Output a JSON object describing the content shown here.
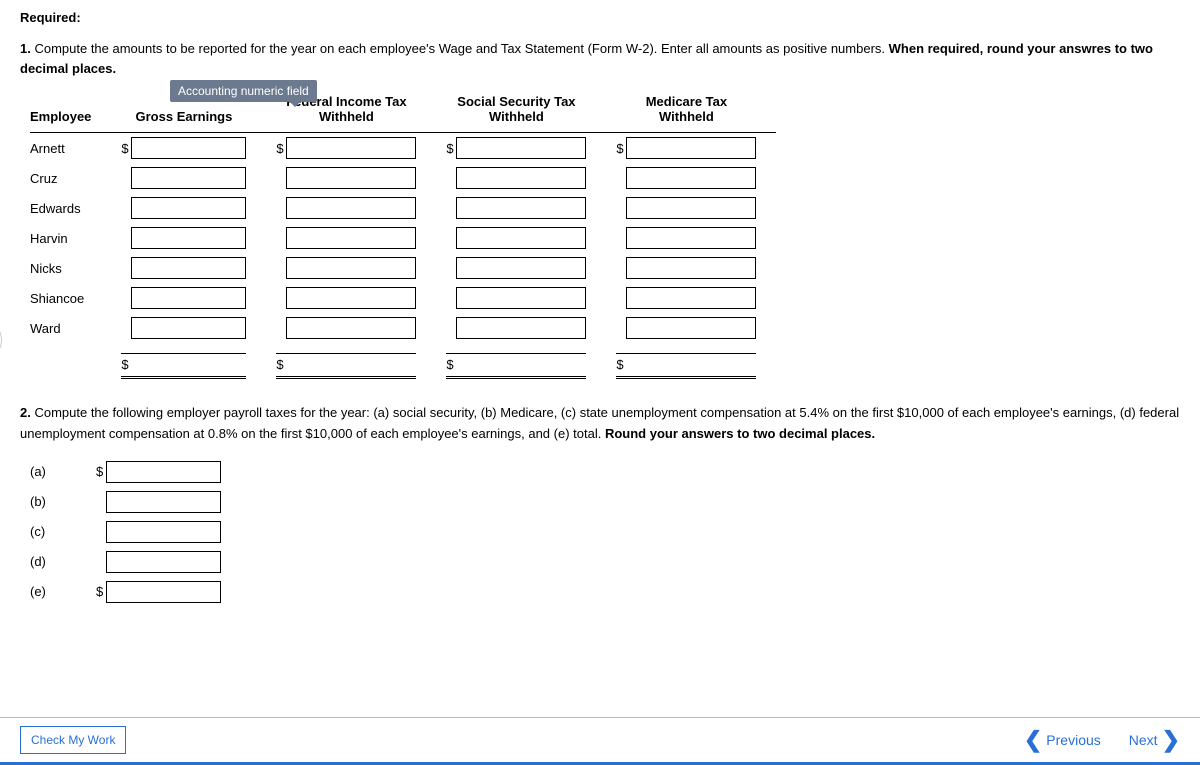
{
  "required_label": "Required:",
  "q1": {
    "num": "1.",
    "text_a": "  Compute the amounts to be reported for the year on each employee's Wage and Tax Statement (Form W-2). Enter all amounts as positive numbers. ",
    "bold": "When required, round your answres to two decimal places."
  },
  "tooltip": "Accounting numeric field",
  "headers": {
    "employee": "Employee",
    "gross": "Gross Earnings",
    "fed_a": "Federal Income Tax",
    "fed_b": "Withheld",
    "ss_a": "Social Security Tax",
    "ss_b": "Withheld",
    "med_a": "Medicare Tax",
    "med_b": "Withheld"
  },
  "employees": [
    "Arnett",
    "Cruz",
    "Edwards",
    "Harvin",
    "Nicks",
    "Shiancoe",
    "Ward"
  ],
  "dollar": "$",
  "q2": {
    "num": "2.",
    "text": "  Compute the following employer payroll taxes for the year: (a) social security, (b) Medicare, (c) state unemployment compensation at 5.4% on the first $10,000 of each employee's earnings, (d) federal unemployment compensation at 0.8% on the first $10,000 of each employee's earnings, and (e) total. ",
    "bold": "Round your answers to two decimal places."
  },
  "parts": [
    "(a)",
    "(b)",
    "(c)",
    "(d)",
    "(e)"
  ],
  "footer": {
    "check": "Check My Work",
    "prev": "Previous",
    "next": "Next"
  }
}
